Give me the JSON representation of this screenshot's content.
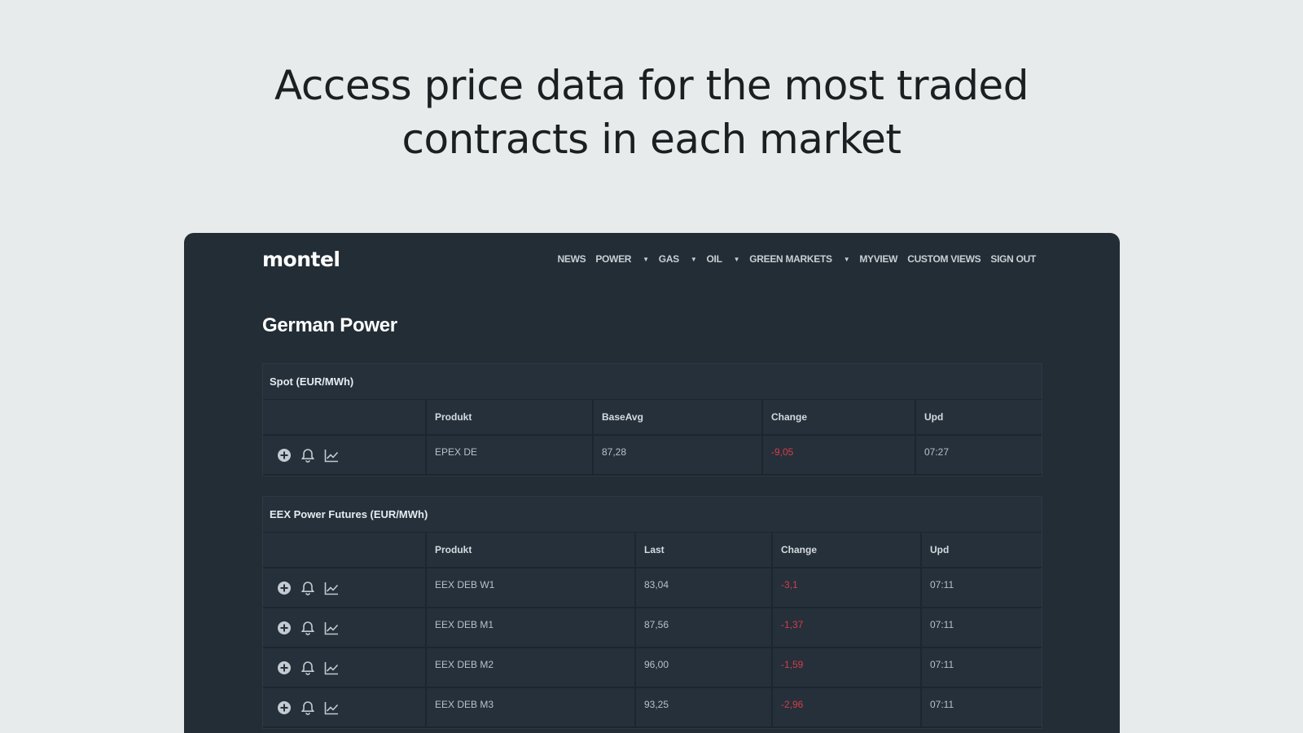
{
  "headline": {
    "line1": "Access price data for the most traded",
    "line2": "contracts in each market"
  },
  "app": {
    "logo": "montel",
    "nav": [
      {
        "label": "NEWS",
        "dropdown": false
      },
      {
        "label": "POWER",
        "dropdown": true
      },
      {
        "label": "GAS",
        "dropdown": true
      },
      {
        "label": "OIL",
        "dropdown": true
      },
      {
        "label": "GREEN MARKETS",
        "dropdown": true
      },
      {
        "label": "MYVIEW",
        "dropdown": false
      },
      {
        "label": "CUSTOM VIEWS",
        "dropdown": false
      },
      {
        "label": "SIGN OUT",
        "dropdown": false
      }
    ],
    "page_title": "German Power"
  },
  "spot": {
    "title": "Spot (EUR/MWh)",
    "headers": [
      "",
      "Produkt",
      "BaseAvg",
      "Change",
      "Upd"
    ],
    "rows": [
      {
        "product": "EPEX DE",
        "value": "87,28",
        "change": "-9,05",
        "upd": "07:27"
      }
    ]
  },
  "futures": {
    "title": "EEX Power Futures (EUR/MWh)",
    "headers": [
      "",
      "Produkt",
      "Last",
      "Change",
      "Upd"
    ],
    "rows": [
      {
        "product": "EEX DEB W1",
        "value": "83,04",
        "change": "-3,1",
        "upd": "07:11"
      },
      {
        "product": "EEX DEB M1",
        "value": "87,56",
        "change": "-1,37",
        "upd": "07:11"
      },
      {
        "product": "EEX DEB M2",
        "value": "96,00",
        "change": "-1,59",
        "upd": "07:11"
      },
      {
        "product": "EEX DEB M3",
        "value": "93,25",
        "change": "-2,96",
        "upd": "07:11"
      }
    ]
  },
  "icons": [
    "add-icon",
    "bell-icon",
    "chart-icon"
  ],
  "colors": {
    "page_bg": "#e8ebec",
    "app_bg": "#222d36",
    "negative": "#d63d4a"
  }
}
